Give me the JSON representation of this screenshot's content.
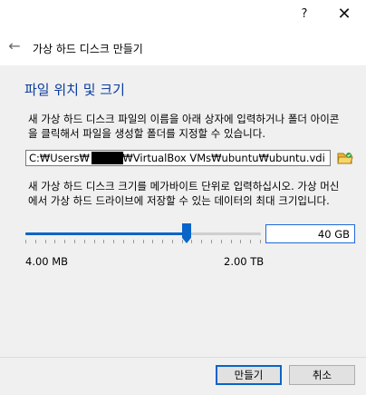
{
  "titlebar": {
    "help_label": "?",
    "close_label": "✕"
  },
  "header": {
    "back_label": "←",
    "title": "가상 하드 디스크 만들기"
  },
  "section": {
    "title": "파일 위치 및 크기"
  },
  "description1": "새 가상 하드 디스크 파일의 이름을 아래 상자에 입력하거나 폴더 아이콘을 클릭해서 파일을 생성할 폴더를 지정할 수 있습니다.",
  "file_path": {
    "value": "C:₩Users₩          ₩VirtualBox VMs₩ubuntu₩ubuntu.vdi",
    "folder_icon": "folder-open-icon"
  },
  "description2": "새 가상 하드 디스크 크기를 메가바이트 단위로 입력하십시오. 가상 머신에서 가상 하드 드라이브에 저장할 수 있는 데이터의 최대 크기입니다.",
  "slider": {
    "min_label": "4.00 MB",
    "max_label": "2.00 TB",
    "level": 0.685,
    "tick_count": 25,
    "accent": "#0a65c8"
  },
  "size": {
    "value": "40 GB"
  },
  "buttons": {
    "create": "만들기",
    "cancel": "취소"
  }
}
